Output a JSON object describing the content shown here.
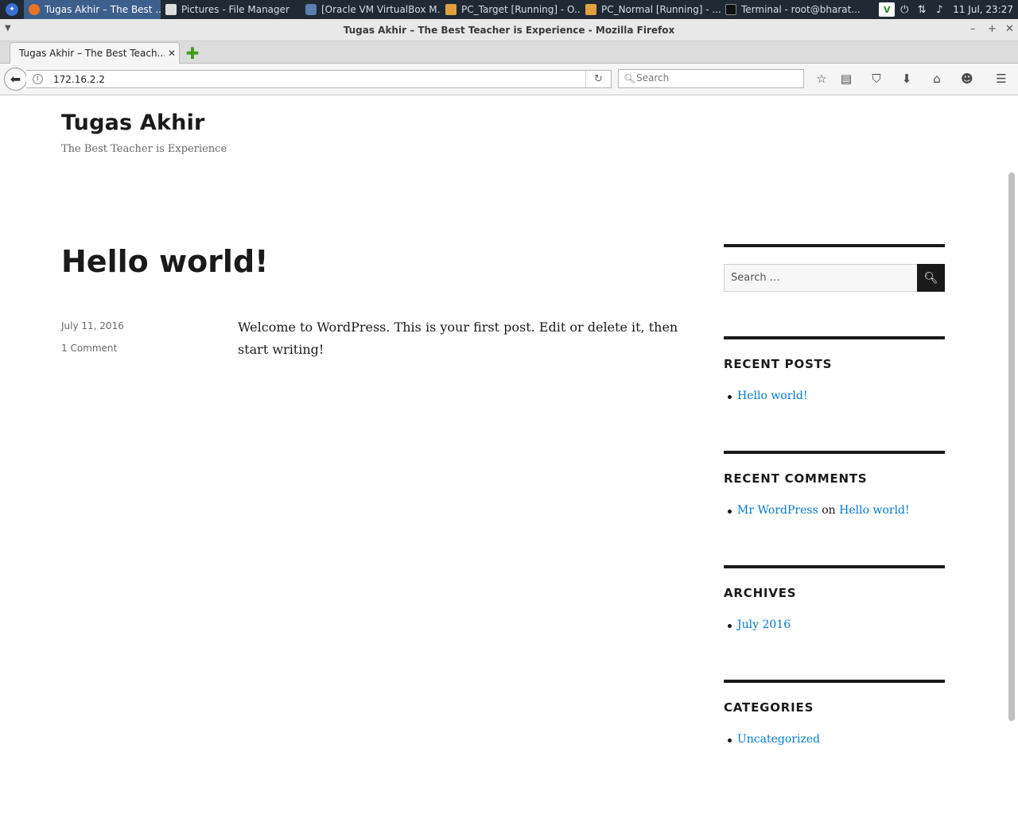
{
  "taskbar": {
    "tasks": [
      {
        "label": "Tugas Akhir – The Best ...",
        "icon": "firefox-icon"
      },
      {
        "label": "Pictures - File Manager",
        "icon": "file-manager-icon"
      },
      {
        "label": "[Oracle VM VirtualBox M...",
        "icon": "virtualbox-icon"
      },
      {
        "label": "PC_Target [Running] - O...",
        "icon": "virtualbox-vm-icon"
      },
      {
        "label": "PC_Normal [Running] - ...",
        "icon": "virtualbox-vm-icon"
      },
      {
        "label": "Terminal - root@bharat...",
        "icon": "terminal-icon"
      }
    ],
    "clock": "11 Jul, 23:27"
  },
  "window": {
    "title": "Tugas Akhir – The Best Teacher is Experience - Mozilla Firefox"
  },
  "browser": {
    "tab_label": "Tugas Akhir – The Best Teach...",
    "url": "172.16.2.2",
    "search_placeholder": "Search"
  },
  "site": {
    "title": "Tugas Akhir",
    "description": "The Best Teacher is Experience"
  },
  "post": {
    "title": "Hello world!",
    "date": "July 11, 2016",
    "comments": "1 Comment",
    "body": "Welcome to WordPress. This is your first post. Edit or delete it, then start writing!"
  },
  "sidebar": {
    "search_placeholder": "Search …",
    "recent_posts": {
      "title": "RECENT POSTS",
      "items": [
        "Hello world!"
      ]
    },
    "recent_comments": {
      "title": "RECENT COMMENTS",
      "author": "Mr WordPress",
      "on": "on",
      "post": "Hello world!"
    },
    "archives": {
      "title": "ARCHIVES",
      "items": [
        "July 2016"
      ]
    },
    "categories": {
      "title": "CATEGORIES",
      "items": [
        "Uncategorized"
      ]
    }
  },
  "colors": {
    "link": "#007acc",
    "taskbar_bg": "#1f2a35",
    "active_task": "#3d5f8c"
  }
}
